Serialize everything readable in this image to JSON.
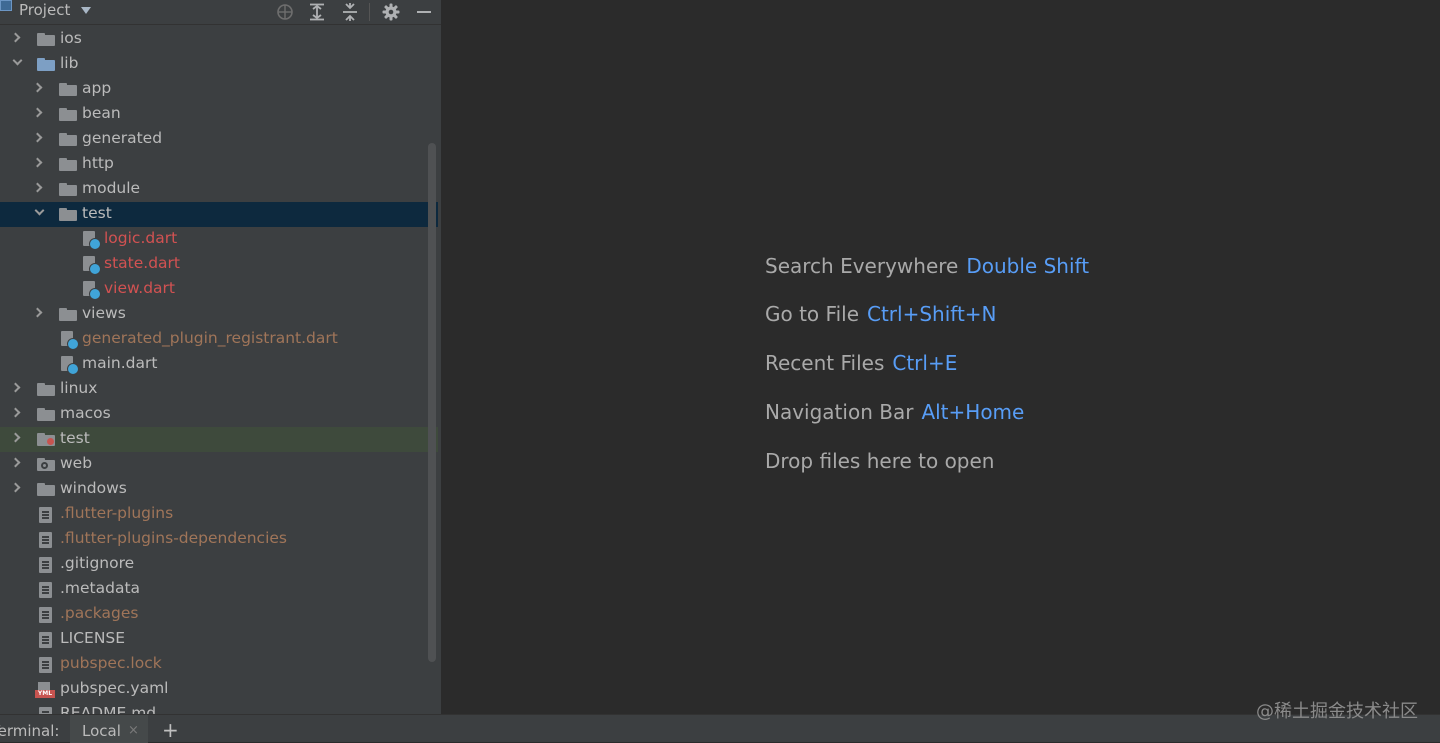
{
  "panel": {
    "title": "Project"
  },
  "tree": [
    {
      "label": "ios",
      "type": "folder",
      "indent": 0,
      "expand": "closed"
    },
    {
      "label": "lib",
      "type": "folder-blue",
      "indent": 0,
      "expand": "open"
    },
    {
      "label": "app",
      "type": "folder",
      "indent": 1,
      "expand": "closed"
    },
    {
      "label": "bean",
      "type": "folder",
      "indent": 1,
      "expand": "closed"
    },
    {
      "label": "generated",
      "type": "folder",
      "indent": 1,
      "expand": "closed"
    },
    {
      "label": "http",
      "type": "folder",
      "indent": 1,
      "expand": "closed"
    },
    {
      "label": "module",
      "type": "folder",
      "indent": 1,
      "expand": "closed"
    },
    {
      "label": "test",
      "type": "folder",
      "indent": 1,
      "expand": "open",
      "state": "selected"
    },
    {
      "label": "logic.dart",
      "type": "dart",
      "indent": 2,
      "color": "red"
    },
    {
      "label": "state.dart",
      "type": "dart",
      "indent": 2,
      "color": "red"
    },
    {
      "label": "view.dart",
      "type": "dart",
      "indent": 2,
      "color": "red"
    },
    {
      "label": "views",
      "type": "folder",
      "indent": 1,
      "expand": "closed"
    },
    {
      "label": "generated_plugin_registrant.dart",
      "type": "dart",
      "indent": 1,
      "color": "ignored"
    },
    {
      "label": "main.dart",
      "type": "dart",
      "indent": 1
    },
    {
      "label": "linux",
      "type": "folder",
      "indent": 0,
      "expand": "closed"
    },
    {
      "label": "macos",
      "type": "folder",
      "indent": 0,
      "expand": "closed"
    },
    {
      "label": "test",
      "type": "folder-test",
      "indent": 0,
      "expand": "closed",
      "state": "hover"
    },
    {
      "label": "web",
      "type": "folder-web",
      "indent": 0,
      "expand": "closed"
    },
    {
      "label": "windows",
      "type": "folder",
      "indent": 0,
      "expand": "closed"
    },
    {
      "label": ".flutter-plugins",
      "type": "file",
      "indent": 0,
      "color": "ignored"
    },
    {
      "label": ".flutter-plugins-dependencies",
      "type": "file",
      "indent": 0,
      "color": "ignored"
    },
    {
      "label": ".gitignore",
      "type": "file",
      "indent": 0
    },
    {
      "label": ".metadata",
      "type": "file",
      "indent": 0
    },
    {
      "label": ".packages",
      "type": "file",
      "indent": 0,
      "color": "ignored"
    },
    {
      "label": "LICENSE",
      "type": "file",
      "indent": 0
    },
    {
      "label": "pubspec.lock",
      "type": "file",
      "indent": 0,
      "color": "ignored"
    },
    {
      "label": "pubspec.yaml",
      "type": "yaml",
      "indent": 0,
      "badge": "YML"
    },
    {
      "label": "README.md",
      "type": "file",
      "indent": 0
    }
  ],
  "hints": [
    {
      "text": "Search Everywhere",
      "key": "Double Shift"
    },
    {
      "text": "Go to File",
      "key": "Ctrl+Shift+N"
    },
    {
      "text": "Recent Files",
      "key": "Ctrl+E"
    },
    {
      "text": "Navigation Bar",
      "key": "Alt+Home"
    },
    {
      "text": "Drop files here to open",
      "key": ""
    }
  ],
  "terminal": {
    "label": "Terminal:",
    "tab": "Local",
    "close": "×",
    "add": "+"
  },
  "watermark": "@稀土掘金技术社区",
  "colors": {
    "panel_bg": "#3c3f41",
    "editor_bg": "#2b2b2b",
    "selected_row": "#0d293e",
    "shortcut_key": "#589df6",
    "untracked_file": "#d25252",
    "ignored_file": "#a07559"
  }
}
